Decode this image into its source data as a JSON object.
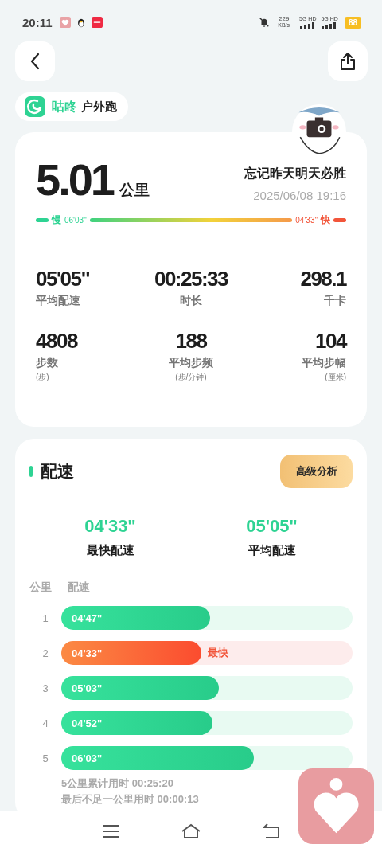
{
  "status_bar": {
    "time": "20:11",
    "speed": "229",
    "speed_unit": "KB/s",
    "networks": [
      "5G HD",
      "5G HD"
    ],
    "battery": "88"
  },
  "app_tag": {
    "brand": "咕咚",
    "title": "户外跑"
  },
  "summary": {
    "distance": "5.01",
    "distance_unit": "公里",
    "name": "忘记昨天明天必胜",
    "datetime": "2025/06/08 19:16",
    "pace_scale": {
      "slow_label": "慢",
      "slow_value": "06'03\"",
      "fast_value": "04'33\"",
      "fast_label": "快"
    },
    "stats": [
      {
        "value": "05'05\"",
        "label": "平均配速"
      },
      {
        "value": "00:25:33",
        "label": "时长"
      },
      {
        "value": "298.1",
        "label": "千卡"
      },
      {
        "value": "4808",
        "label": "步数",
        "unit": "(步)"
      },
      {
        "value": "188",
        "label": "平均步频",
        "unit": "(步/分钟)"
      },
      {
        "value": "104",
        "label": "平均步幅",
        "unit": "(厘米)"
      }
    ]
  },
  "pace": {
    "title": "配速",
    "button": "高级分析",
    "highlights": [
      {
        "value": "04'33\"",
        "label": "最快配速"
      },
      {
        "value": "05'05\"",
        "label": "平均配速"
      }
    ],
    "columns": [
      "公里",
      "配速"
    ],
    "rows": [
      {
        "km": "1",
        "pace": "04'47\"",
        "level": 0.51,
        "fastest": false
      },
      {
        "km": "2",
        "pace": "04'33\"",
        "level": 0.48,
        "fastest": true,
        "tag": "最快"
      },
      {
        "km": "3",
        "pace": "05'03\"",
        "level": 0.54,
        "fastest": false
      },
      {
        "km": "4",
        "pace": "04'52\"",
        "level": 0.52,
        "fastest": false
      },
      {
        "km": "5",
        "pace": "06'03\"",
        "level": 0.66,
        "fastest": false
      }
    ],
    "notes": [
      "5公里累计用时 00:25:20",
      "最后不足一公里用时 00:00:13"
    ]
  }
}
